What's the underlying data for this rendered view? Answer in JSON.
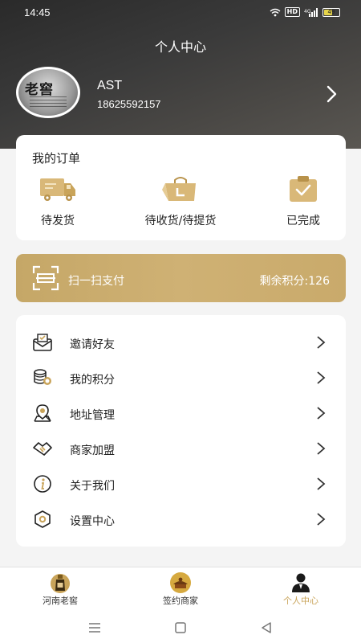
{
  "status": {
    "time": "14:45",
    "hd": "HD",
    "signal": "4G",
    "battery": "49"
  },
  "header": {
    "title": "个人中心"
  },
  "user": {
    "avatar_text": "老窖",
    "name": "AST",
    "phone": "18625592157"
  },
  "orders": {
    "title": "我的订单",
    "items": [
      {
        "label": "待发货",
        "icon": "truck-icon"
      },
      {
        "label": "待收货/待提货",
        "icon": "shopping-bag-icon"
      },
      {
        "label": "已完成",
        "icon": "clipboard-check-icon"
      }
    ]
  },
  "scan": {
    "label": "扫一扫支付",
    "points": "剩余积分:126"
  },
  "menu": {
    "items": [
      {
        "label": "邀请好友",
        "icon": "invite-envelope-icon"
      },
      {
        "label": "我的积分",
        "icon": "coins-icon"
      },
      {
        "label": "地址管理",
        "icon": "location-pin-icon"
      },
      {
        "label": "商家加盟",
        "icon": "handshake-icon"
      },
      {
        "label": "关于我们",
        "icon": "info-icon"
      },
      {
        "label": "设置中心",
        "icon": "settings-hexagon-icon"
      }
    ]
  },
  "tabs": [
    {
      "label": "河南老窖",
      "icon": "liquor-bottle-icon"
    },
    {
      "label": "签约商家",
      "icon": "merchant-icon"
    },
    {
      "label": "个人中心",
      "icon": "person-icon",
      "active": true
    }
  ],
  "colors": {
    "accent": "#c9a45a",
    "gold_bar": "#c9aa6b",
    "header_dark": "#2e2e2e"
  }
}
